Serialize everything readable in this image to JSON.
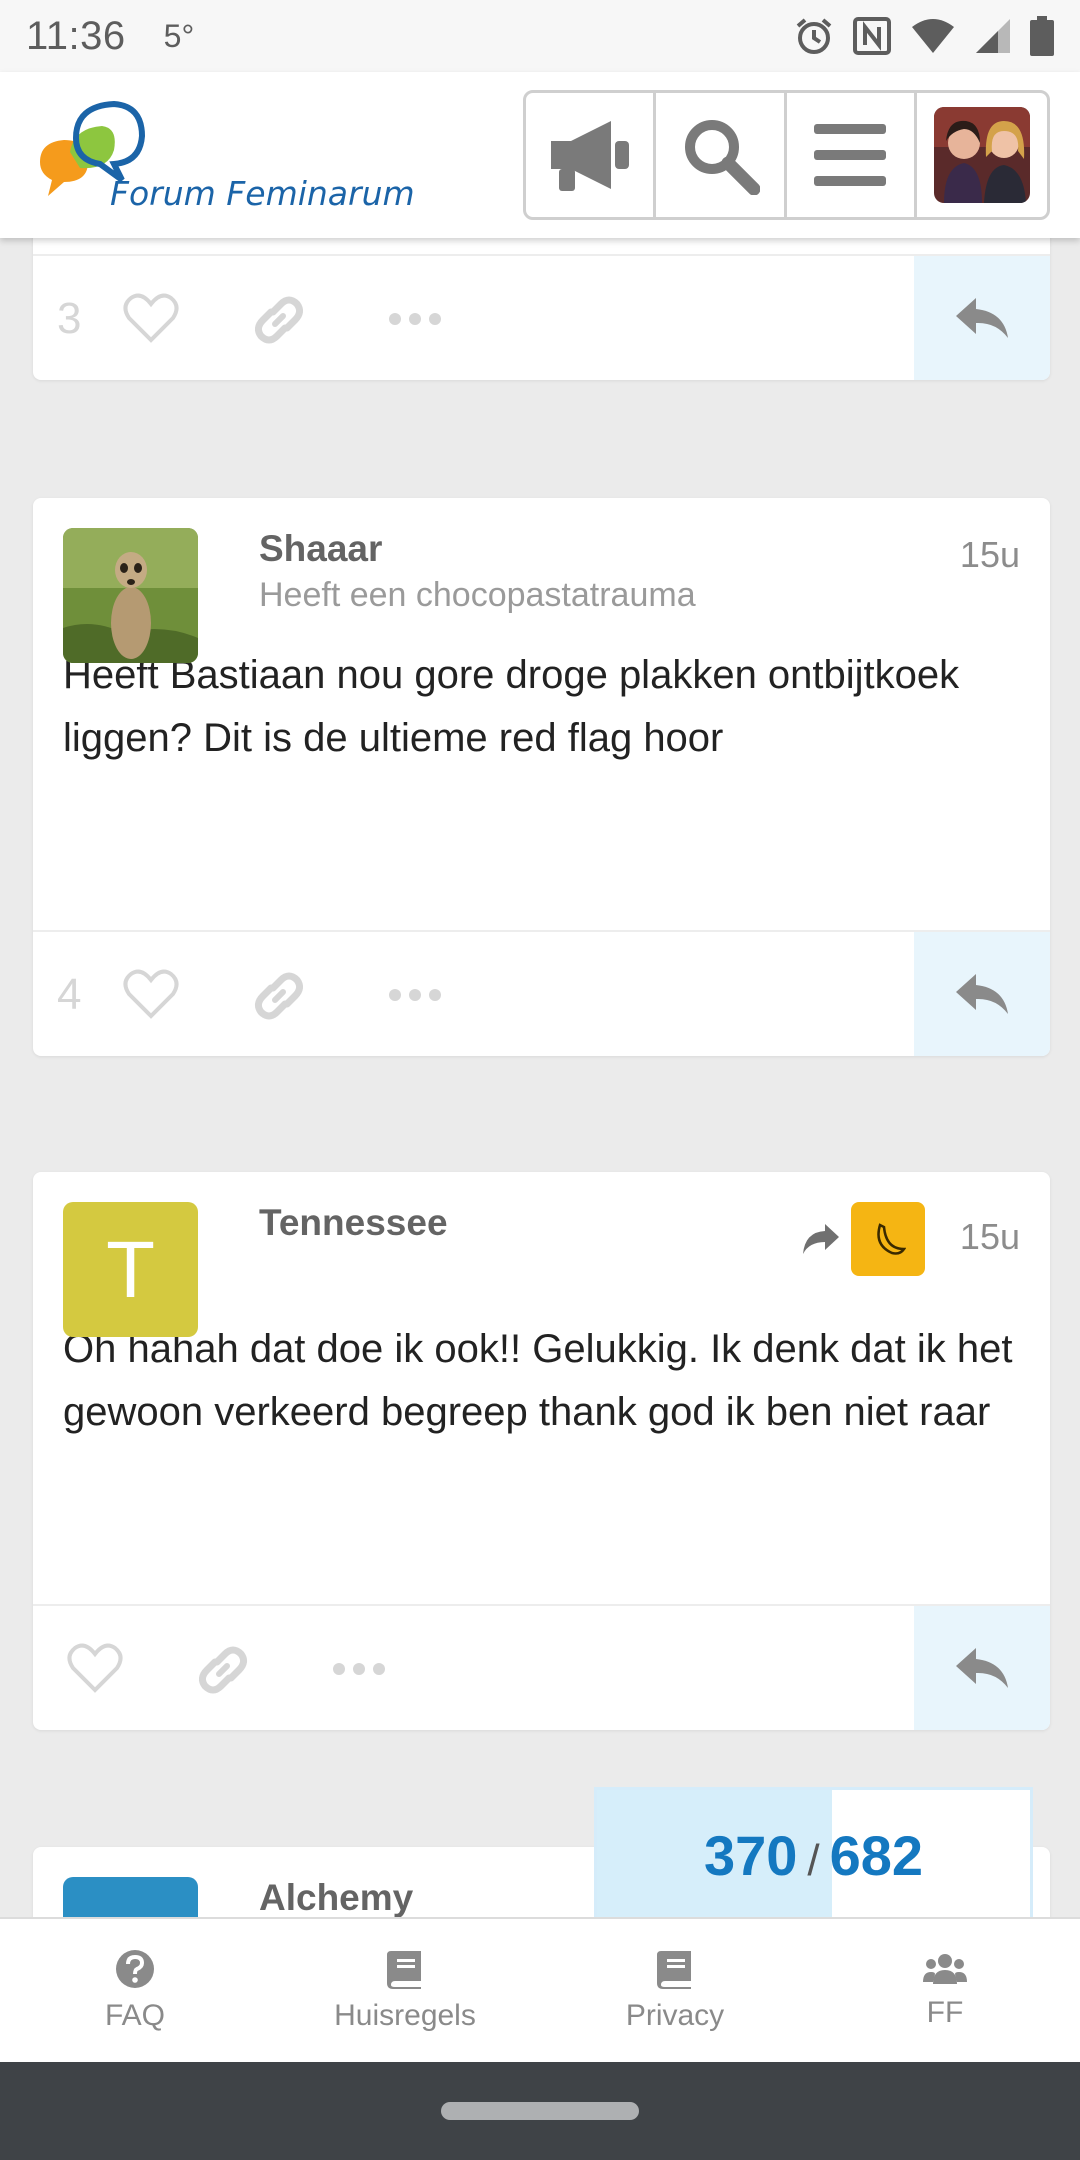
{
  "status_bar": {
    "time": "11:36",
    "temperature": "5°",
    "icons": [
      "alarm-icon",
      "nfc-icon",
      "wifi-icon",
      "signal-icon",
      "battery-icon"
    ]
  },
  "header": {
    "logo_text": "Forum Feminarum",
    "buttons": [
      "announcements-icon",
      "search-icon",
      "menu-icon",
      "user-avatar"
    ]
  },
  "posts": [
    {
      "like_count": "3"
    },
    {
      "username": "Shaaar",
      "user_title": "Heeft een chocopastatrauma",
      "time": "15u",
      "body": "Heeft Bastiaan nou gore droge plakken ontbijtkoek liggen? Dit is de ultieme red flag hoor",
      "like_count": "4"
    },
    {
      "username": "Tennessee",
      "avatar_letter": "T",
      "time": "15u",
      "body": "Oh hahah dat doe ik ook!! Gelukkig. Ik denk dat ik het gewoon verkeerd begreep thank god ik ben niet raar",
      "like_count": ""
    },
    {
      "username": "Alchemy"
    }
  ],
  "timeline": {
    "current": "370",
    "separator": "/",
    "total": "682"
  },
  "bottom_nav": {
    "items": [
      {
        "label": "FAQ",
        "icon": "question-circle-icon"
      },
      {
        "label": "Huisregels",
        "icon": "book-icon"
      },
      {
        "label": "Privacy",
        "icon": "book-icon"
      },
      {
        "label": "FF",
        "icon": "users-icon"
      }
    ]
  },
  "colors": {
    "accent": "#1478c0",
    "reply_bg": "#e8f5fc",
    "avatar_tennessee": "#d4c940",
    "reply_to_avatar": "#f5b513"
  }
}
